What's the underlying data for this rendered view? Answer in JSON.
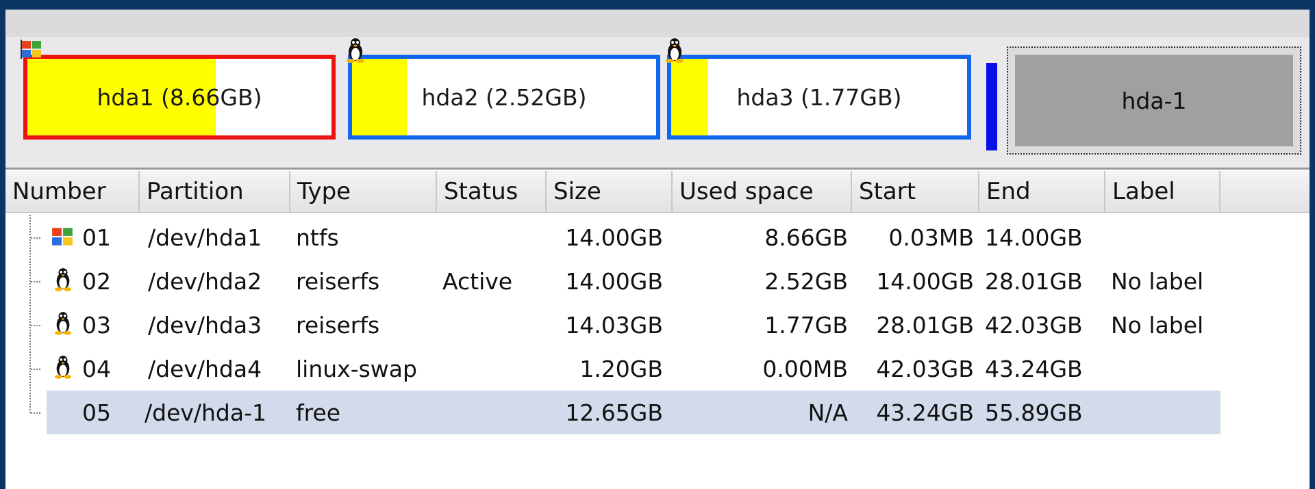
{
  "disk_map": {
    "partitions": [
      {
        "label": "hda1 (8.66GB)",
        "icon": "windows-flag-icon",
        "border_color": "#ee1111",
        "used_fraction": 0.62
      },
      {
        "label": "hda2 (2.52GB)",
        "icon": "tux-penguin-icon",
        "border_color": "#1166ee",
        "used_fraction": 0.18
      },
      {
        "label": "hda3 (1.77GB)",
        "icon": "tux-penguin-icon",
        "border_color": "#1166ee",
        "used_fraction": 0.125
      }
    ],
    "swap_color": "#0a10e8",
    "free": {
      "label": "hda-1"
    }
  },
  "table": {
    "columns": [
      "Number",
      "Partition",
      "Type",
      "Status",
      "Size",
      "Used space",
      "Start",
      "End",
      "Label"
    ],
    "rows": [
      {
        "number": "01",
        "partition": "/dev/hda1",
        "type": "ntfs",
        "status": "",
        "size": "14.00GB",
        "used": "8.66GB",
        "start": "0.03MB",
        "end": "14.00GB",
        "label": "",
        "icon": "windows-flag-icon"
      },
      {
        "number": "02",
        "partition": "/dev/hda2",
        "type": "reiserfs",
        "status": "Active",
        "size": "14.00GB",
        "used": "2.52GB",
        "start": "14.00GB",
        "end": "28.01GB",
        "label": "No label",
        "icon": "tux-penguin-icon"
      },
      {
        "number": "03",
        "partition": "/dev/hda3",
        "type": "reiserfs",
        "status": "",
        "size": "14.03GB",
        "used": "1.77GB",
        "start": "28.01GB",
        "end": "42.03GB",
        "label": "No label",
        "icon": "tux-penguin-icon"
      },
      {
        "number": "04",
        "partition": "/dev/hda4",
        "type": "linux-swap",
        "status": "",
        "size": "1.20GB",
        "used": "0.00MB",
        "start": "42.03GB",
        "end": "43.24GB",
        "label": "",
        "icon": "tux-penguin-icon"
      },
      {
        "number": "05",
        "partition": "/dev/hda-1",
        "type": "free",
        "status": "",
        "size": "12.65GB",
        "used": "N/A",
        "start": "43.24GB",
        "end": "55.89GB",
        "label": "",
        "icon": "",
        "selected": true
      }
    ]
  },
  "colors": {
    "used_fill": "#ffff00",
    "selection": "#d1dbeb",
    "free_block": "#a19fa1"
  }
}
